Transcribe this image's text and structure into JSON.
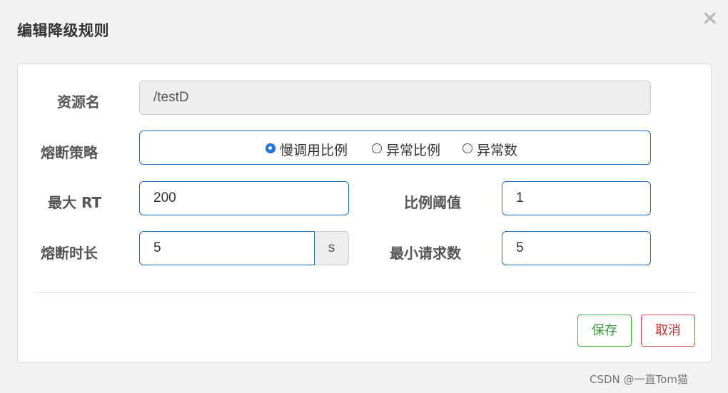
{
  "dialog": {
    "title": "编辑降级规则",
    "close_glyph": "×"
  },
  "form": {
    "resource": {
      "label": "资源名",
      "value": "/testD",
      "disabled": true
    },
    "strategy": {
      "label": "熔断策略",
      "options": [
        {
          "label": "慢调用比例",
          "checked": true
        },
        {
          "label": "异常比例",
          "checked": false
        },
        {
          "label": "异常数",
          "checked": false
        }
      ]
    },
    "max_rt": {
      "label": "最大 RT",
      "value": "200"
    },
    "ratio_threshold": {
      "label": "比例阈值",
      "value": "1"
    },
    "break_duration": {
      "label": "熔断时长",
      "value": "5",
      "unit": "s"
    },
    "min_requests": {
      "label": "最小请求数",
      "value": "5"
    }
  },
  "buttons": {
    "save_label": "保存",
    "cancel_label": "取消"
  },
  "watermark": "CSDN @一直Tom猫",
  "colors": {
    "input_border": "#1f6fb5",
    "radio_checked": "#1a73e8",
    "save": "#4cae4c",
    "cancel": "#d9534f"
  }
}
